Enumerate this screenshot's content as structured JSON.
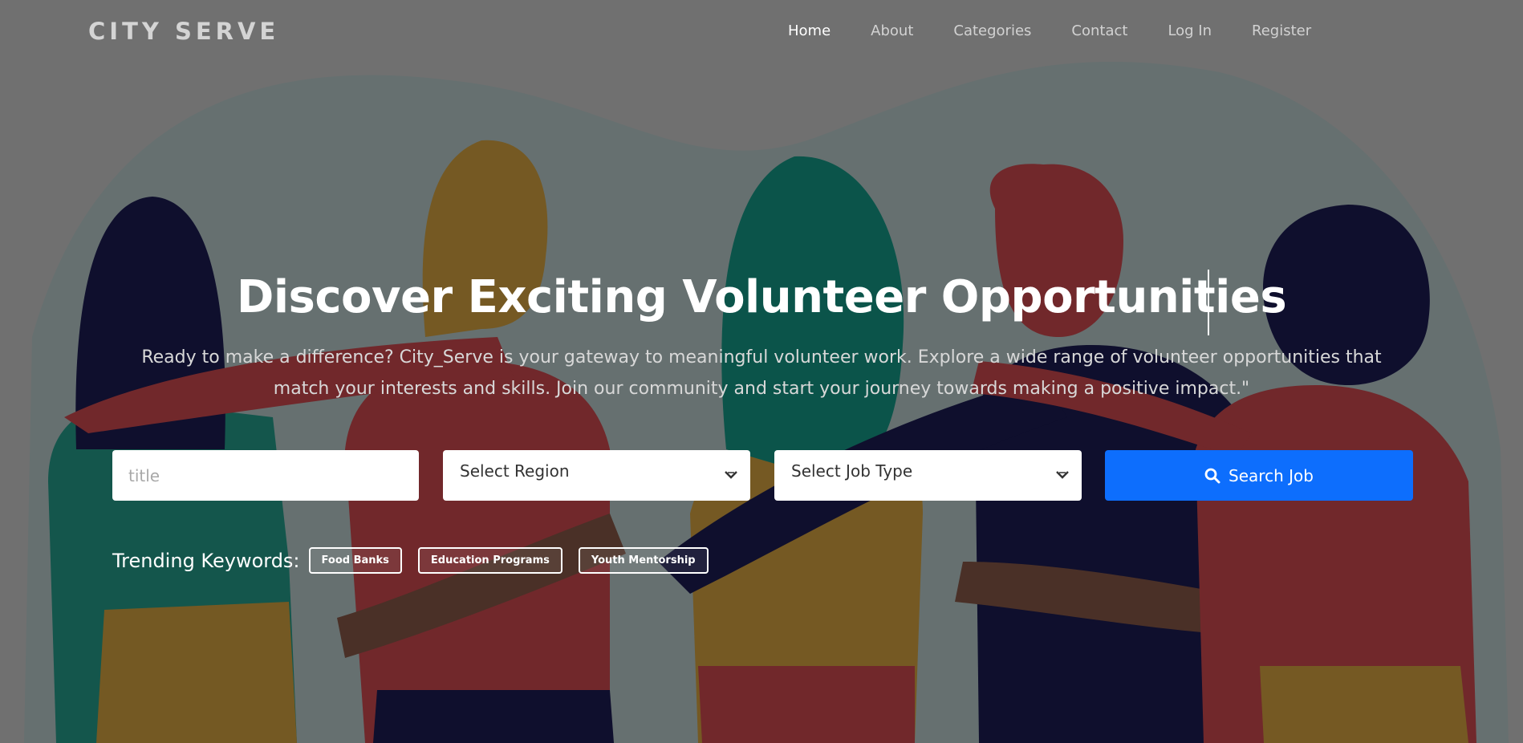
{
  "logo": "CITY SERVE",
  "nav": {
    "items": [
      {
        "label": "Home",
        "active": true
      },
      {
        "label": "About"
      },
      {
        "label": "Categories"
      },
      {
        "label": "Contact"
      },
      {
        "label": "Log In"
      },
      {
        "label": "Register"
      }
    ]
  },
  "hero": {
    "title": "Discover Exciting Volunteer Opportunities",
    "subtitle": "Ready to make a difference? City_Serve is your gateway to meaningful volunteer work. Explore a wide range of volunteer opportunities that match your interests and skills. Join our community and start your journey towards making a positive impact.\""
  },
  "search": {
    "title_placeholder": "title",
    "region_label": "Select Region",
    "job_type_label": "Select Job Type",
    "button_label": "Search Job",
    "button_color": "#0d6efd"
  },
  "trending": {
    "label": "Trending Keywords:",
    "tags": [
      "Food Banks",
      "Education Programs",
      "Youth Mentorship"
    ]
  },
  "icons": [
    "search-icon",
    "chevron-down-icon"
  ]
}
